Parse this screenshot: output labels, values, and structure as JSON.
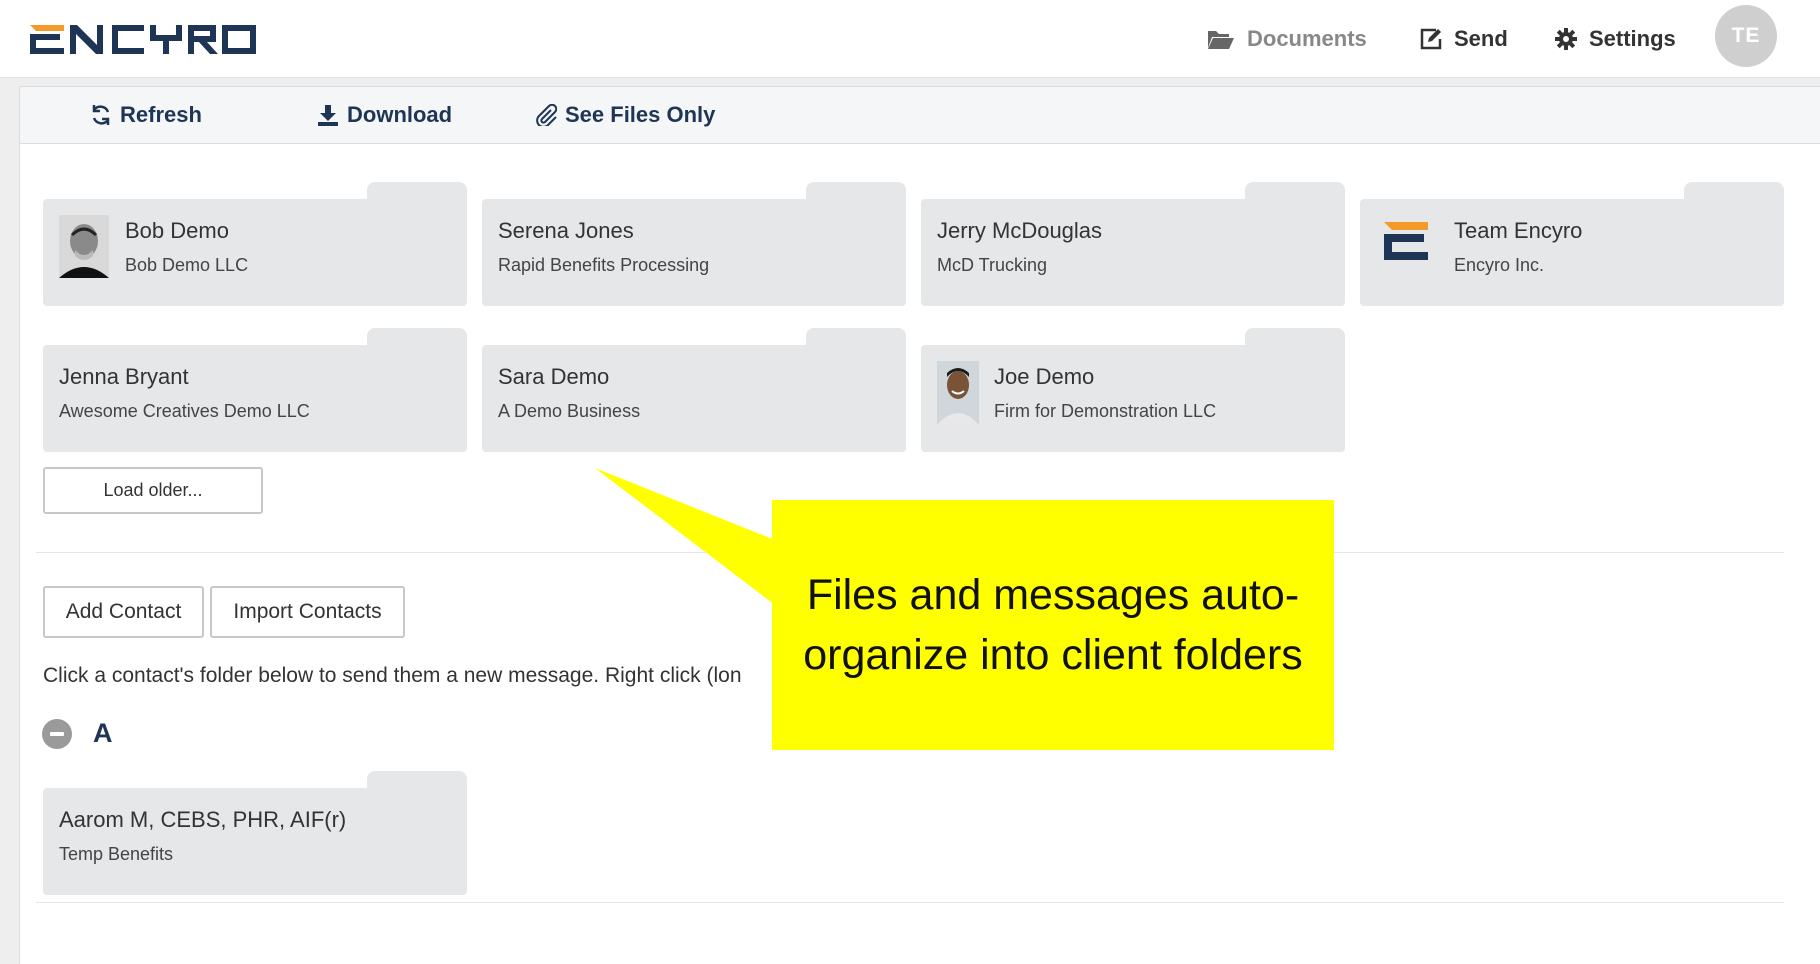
{
  "header": {
    "logo_text": "ENCYRO",
    "nav": [
      {
        "label": "Documents",
        "icon": "folder-open-icon"
      },
      {
        "label": "Send",
        "icon": "edit-icon"
      },
      {
        "label": "Settings",
        "icon": "gear-icon"
      }
    ],
    "avatar_initials": "TE"
  },
  "toolbar": {
    "refresh_label": "Refresh",
    "download_label": "Download",
    "see_files_label": "See Files Only"
  },
  "recent_folders": [
    {
      "name": "Bob Demo",
      "company": "Bob Demo LLC",
      "has_photo": true
    },
    {
      "name": "Serena Jones",
      "company": "Rapid Benefits Processing",
      "has_photo": false
    },
    {
      "name": "Jerry McDouglas",
      "company": "McD Trucking",
      "has_photo": false
    },
    {
      "name": "Team Encyro",
      "company": "Encyro Inc.",
      "has_photo": true
    },
    {
      "name": "Jenna Bryant",
      "company": "Awesome Creatives Demo LLC",
      "has_photo": false
    },
    {
      "name": "Sara Demo",
      "company": "A Demo Business",
      "has_photo": false
    },
    {
      "name": "Joe Demo",
      "company": "Firm for Demonstration LLC",
      "has_photo": true
    }
  ],
  "load_older_label": "Load older...",
  "contacts": {
    "add_contact_label": "Add Contact",
    "import_contacts_label": "Import Contacts",
    "help_text": "Click a contact's folder below to send them a new message. Right click (lon",
    "group_letter": "A",
    "folders": [
      {
        "name": "Aarom M, CEBS, PHR, AIF(r)",
        "company": "Temp Benefits"
      }
    ]
  },
  "callout": {
    "text": "Files and messages auto-organize into client folders"
  },
  "colors": {
    "brand_navy": "#1f3556",
    "brand_orange": "#f39a2b",
    "folder_gray": "#e6e7e9",
    "callout_yellow": "#ffff00"
  }
}
